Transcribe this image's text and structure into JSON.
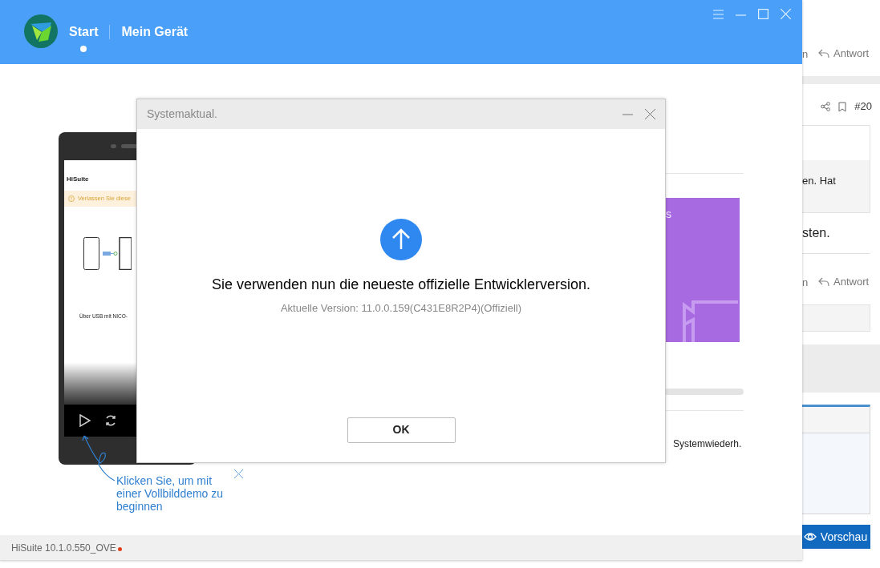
{
  "background_page": {
    "top_actions": {
      "cut_label": "n",
      "reply": "Antwort"
    },
    "post_number": "#20",
    "quote_text": "en. Hat",
    "body_text": "sten.",
    "bottom_actions": {
      "cut_label": "n",
      "reply": "Antwort"
    },
    "preview_button": "Vorschau"
  },
  "app": {
    "tabs": [
      {
        "label": "Start",
        "selected": true
      },
      {
        "label": "Mein Gerät",
        "selected": false
      }
    ],
    "phone_preview": {
      "app_title": "HiSuite",
      "banner": "Verlassen Sie diese",
      "caption": "Über USB mit NICO-"
    },
    "tooltip": "Klicken Sie, um mit einer Vollbilddemo zu beginnen",
    "card_text": "s",
    "action_label": "Systemwiederh.",
    "version": "HiSuite 10.1.0.550_OVE"
  },
  "dialog": {
    "title": "Systemaktual.",
    "message": "Sie verwenden nun die neueste offizielle Entwicklerversion.",
    "version": "Aktuelle Version: 11.0.0.159(C431E8R2P4)(Offiziell)",
    "button": "OK"
  }
}
